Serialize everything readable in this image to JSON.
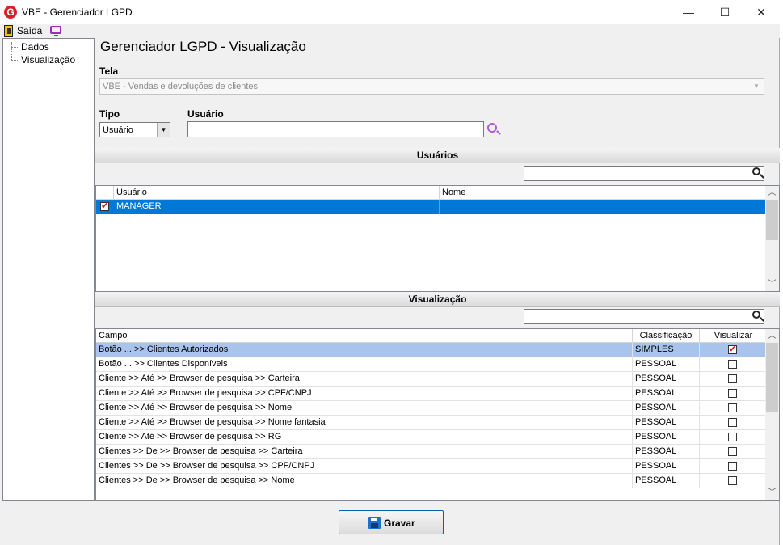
{
  "window": {
    "title": "VBE - Gerenciador LGPD",
    "minimize": "—",
    "maximize": "☐",
    "close": "✕",
    "app_icon": "G"
  },
  "menubar": {
    "exit_label": "Saída"
  },
  "tree": {
    "items": [
      {
        "label": "Dados"
      },
      {
        "label": "Visualização"
      }
    ]
  },
  "page": {
    "title": "Gerenciador LGPD - Visualização"
  },
  "form": {
    "tela_label": "Tela",
    "tela_value": "VBE - Vendas e devoluções de clientes",
    "tipo_label": "Tipo",
    "tipo_value": "Usuário",
    "usuario_label": "Usuário",
    "usuario_value": ""
  },
  "users_section": {
    "title": "Usuários",
    "filter_value": "",
    "columns": [
      "Usuário",
      "Nome"
    ],
    "rows": [
      {
        "checked": true,
        "usuario": "MANAGER",
        "nome": ""
      }
    ]
  },
  "view_section": {
    "title": "Visualização",
    "filter_value": "",
    "columns": [
      "Campo",
      "Classificação",
      "Visualizar"
    ],
    "rows": [
      {
        "campo": "Botão ... >> Clientes Autorizados",
        "classificacao": "SIMPLES",
        "visualizar": true
      },
      {
        "campo": "Botão ... >> Clientes Disponíveis",
        "classificacao": "PESSOAL",
        "visualizar": false
      },
      {
        "campo": "Cliente >> Até >> Browser de pesquisa >> Carteira",
        "classificacao": "PESSOAL",
        "visualizar": false
      },
      {
        "campo": "Cliente >> Até >> Browser de pesquisa >> CPF/CNPJ",
        "classificacao": "PESSOAL",
        "visualizar": false
      },
      {
        "campo": "Cliente >> Até >> Browser de pesquisa >> Nome",
        "classificacao": "PESSOAL",
        "visualizar": false
      },
      {
        "campo": "Cliente >> Até >> Browser de pesquisa >> Nome fantasia",
        "classificacao": "PESSOAL",
        "visualizar": false
      },
      {
        "campo": "Cliente >> Até >> Browser de pesquisa >> RG",
        "classificacao": "PESSOAL",
        "visualizar": false
      },
      {
        "campo": "Clientes >> De >> Browser de pesquisa >> Carteira",
        "classificacao": "PESSOAL",
        "visualizar": false
      },
      {
        "campo": "Clientes >> De >> Browser de pesquisa >> CPF/CNPJ",
        "classificacao": "PESSOAL",
        "visualizar": false
      },
      {
        "campo": "Clientes >> De >> Browser de pesquisa >> Nome",
        "classificacao": "PESSOAL",
        "visualizar": false
      }
    ]
  },
  "footer": {
    "save_label": "Gravar"
  },
  "colors": {
    "selection": "#0078d7",
    "selection_soft": "#a8c4ec",
    "accent_purple": "#a02ac0"
  }
}
